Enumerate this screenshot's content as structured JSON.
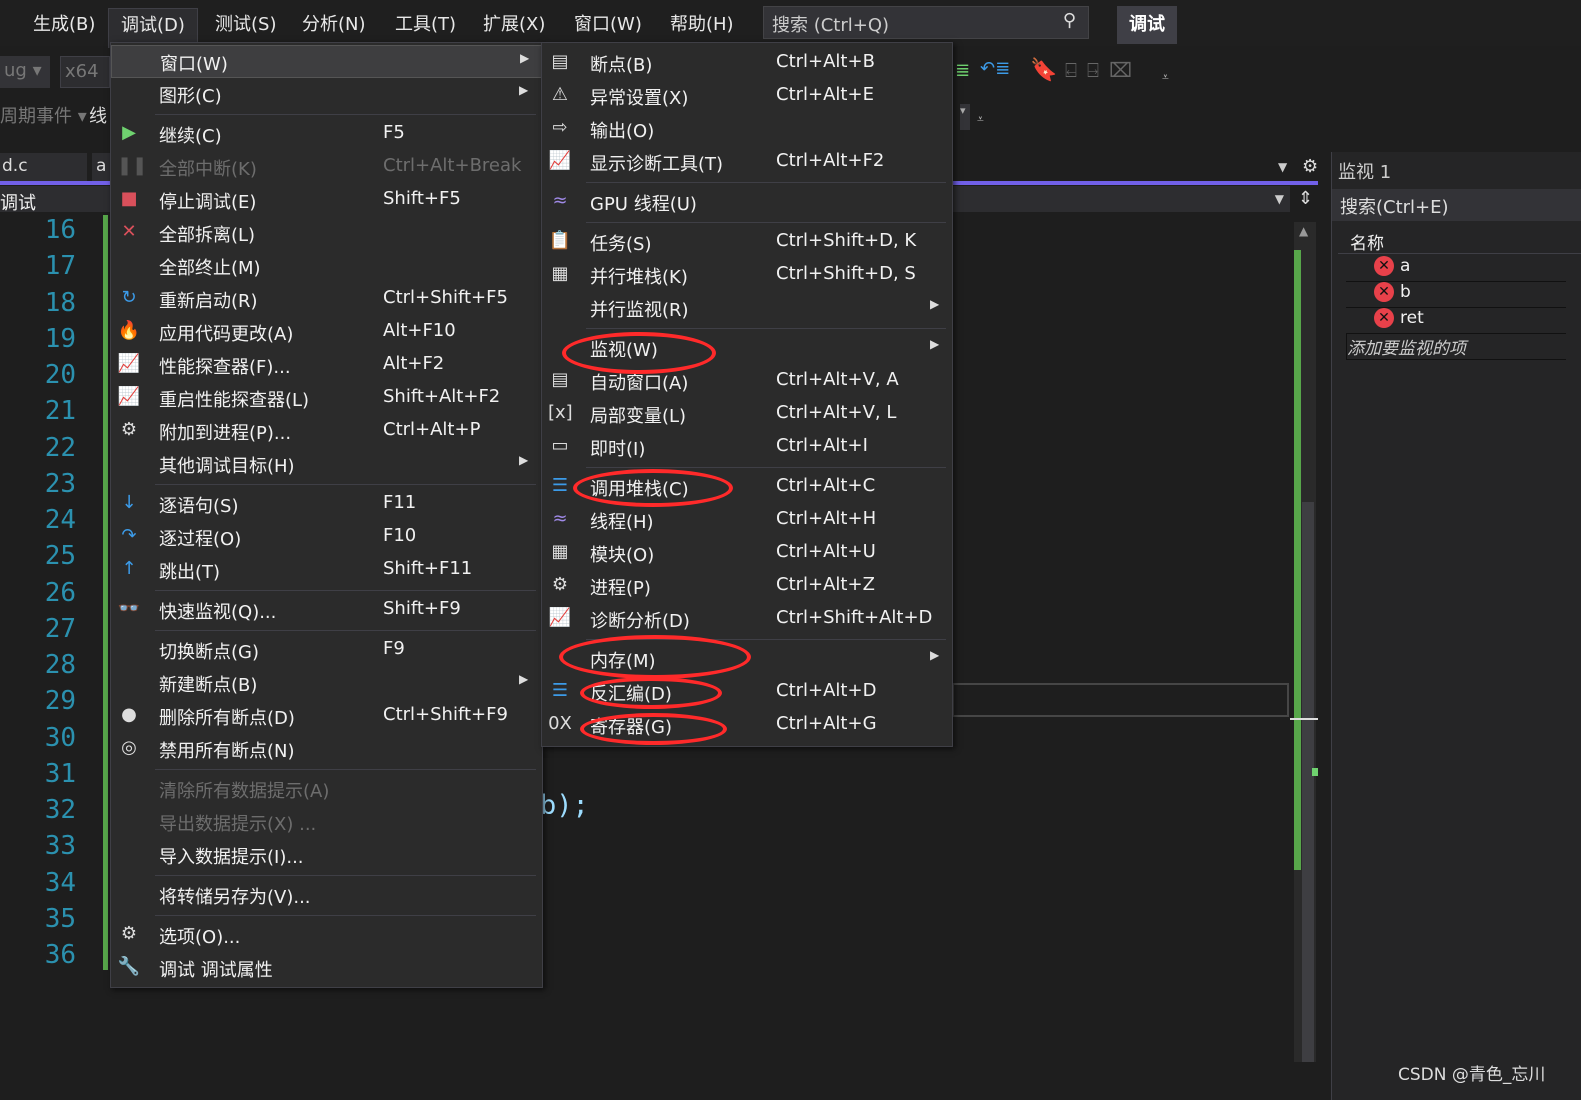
{
  "menubar": {
    "items": [
      "生成(B)",
      "调试(D)",
      "测试(S)",
      "分析(N)",
      "工具(T)",
      "扩展(X)",
      "窗口(W)",
      "帮助(H)"
    ],
    "search_placeholder": "搜索 (Ctrl+Q)",
    "mode_badge": "调试"
  },
  "toolbar": {
    "config": "ug",
    "platform": "x64",
    "lifecycle": "周期事件",
    "thread": "线"
  },
  "tabs": {
    "file1": "d.c",
    "file2": "a",
    "scope": "调试"
  },
  "editor": {
    "line_numbers": [
      "16",
      "17",
      "18",
      "19",
      "20",
      "21",
      "22",
      "23",
      "24",
      "25",
      "26",
      "27",
      "28",
      "29",
      "30",
      "31",
      "32",
      "33",
      "34",
      "35",
      "36"
    ],
    "code_fragment": "b);"
  },
  "debug_menu": [
    {
      "label": "窗口(W)",
      "sub": true,
      "hl": true
    },
    {
      "label": "图形(C)",
      "sub": true
    },
    {
      "sep": true
    },
    {
      "label": "继续(C)",
      "sc": "F5",
      "icon": "play-icon",
      "glyph": "▶",
      "color": "#6fd26f"
    },
    {
      "label": "全部中断(K)",
      "sc": "Ctrl+Alt+Break",
      "icon": "pause-icon",
      "glyph": "❚❚",
      "color": "#555",
      "dis": true
    },
    {
      "label": "停止调试(E)",
      "sc": "Shift+F5",
      "icon": "stop-icon",
      "glyph": "■",
      "color": "#d9505b"
    },
    {
      "label": "全部拆离(L)",
      "icon": "detach-icon",
      "glyph": "✕",
      "color": "#d9505b"
    },
    {
      "label": "全部终止(M)"
    },
    {
      "label": "重新启动(R)",
      "sc": "Ctrl+Shift+F5",
      "icon": "restart-icon",
      "glyph": "↻",
      "color": "#3c9be8"
    },
    {
      "label": "应用代码更改(A)",
      "sc": "Alt+F10",
      "icon": "hot-reload-icon",
      "glyph": "🔥",
      "color": "#e8414a"
    },
    {
      "label": "性能探查器(F)...",
      "sc": "Alt+F2",
      "icon": "profiler-icon",
      "glyph": "📈",
      "color": "#8bc58b"
    },
    {
      "label": "重启性能探查器(L)",
      "sc": "Shift+Alt+F2",
      "icon": "restart-profiler-icon",
      "glyph": "📈",
      "color": "#8bc58b"
    },
    {
      "label": "附加到进程(P)...",
      "sc": "Ctrl+Alt+P",
      "icon": "gears-icon",
      "glyph": "⚙",
      "color": "#ddd"
    },
    {
      "label": "其他调试目标(H)",
      "sub": true
    },
    {
      "sep": true
    },
    {
      "label": "逐语句(S)",
      "sc": "F11",
      "icon": "step-into-icon",
      "glyph": "↓",
      "color": "#3c9be8"
    },
    {
      "label": "逐过程(O)",
      "sc": "F10",
      "icon": "step-over-icon",
      "glyph": "↷",
      "color": "#3c9be8"
    },
    {
      "label": "跳出(T)",
      "sc": "Shift+F11",
      "icon": "step-out-icon",
      "glyph": "↑",
      "color": "#3c9be8"
    },
    {
      "sep": true
    },
    {
      "label": "快速监视(Q)...",
      "sc": "Shift+F9",
      "icon": "glasses-icon",
      "glyph": "👓",
      "color": "#ddd"
    },
    {
      "sep": true
    },
    {
      "label": "切换断点(G)",
      "sc": "F9"
    },
    {
      "label": "新建断点(B)",
      "sub": true
    },
    {
      "label": "删除所有断点(D)",
      "sc": "Ctrl+Shift+F9",
      "icon": "delete-breakpoints-icon",
      "glyph": "●",
      "color": "#ddd"
    },
    {
      "label": "禁用所有断点(N)",
      "icon": "disable-breakpoints-icon",
      "glyph": "◎",
      "color": "#ddd"
    },
    {
      "sep": true
    },
    {
      "label": "清除所有数据提示(A)",
      "dis": true
    },
    {
      "label": "导出数据提示(X) ...",
      "dis": true
    },
    {
      "label": "导入数据提示(I)..."
    },
    {
      "sep": true
    },
    {
      "label": "将转储另存为(V)..."
    },
    {
      "sep": true
    },
    {
      "label": "选项(O)...",
      "icon": "gear-icon",
      "glyph": "⚙",
      "color": "#ddd"
    },
    {
      "label": "调试 调试属性",
      "icon": "wrench-icon",
      "glyph": "🔧",
      "color": "#ddd"
    }
  ],
  "window_submenu": [
    {
      "label": "断点(B)",
      "sc": "Ctrl+Alt+B",
      "icon": "breakpoints-icon",
      "glyph": "▤",
      "color": "#ddd"
    },
    {
      "label": "异常设置(X)",
      "sc": "Ctrl+Alt+E",
      "icon": "exception-icon",
      "glyph": "⚠",
      "color": "#ddd"
    },
    {
      "label": "输出(O)",
      "sc": "",
      "icon": "output-icon",
      "glyph": "⇨",
      "color": "#ddd"
    },
    {
      "label": "显示诊断工具(T)",
      "sc": "Ctrl+Alt+F2",
      "icon": "diagnostics-icon",
      "glyph": "📈",
      "color": "#ddd"
    },
    {
      "sep": true
    },
    {
      "label": "GPU 线程(U)",
      "icon": "gpu-threads-icon",
      "glyph": "≈",
      "color": "#a08ae8"
    },
    {
      "sep": true
    },
    {
      "label": "任务(S)",
      "sc": "Ctrl+Shift+D, K",
      "icon": "tasks-icon",
      "glyph": "📋",
      "color": "#ddd"
    },
    {
      "label": "并行堆栈(K)",
      "sc": "Ctrl+Shift+D, S",
      "icon": "parallel-stacks-icon",
      "glyph": "▦",
      "color": "#ddd"
    },
    {
      "label": "并行监视(R)",
      "sub": true
    },
    {
      "sep": true
    },
    {
      "label": "监视(W)",
      "sub": true
    },
    {
      "label": "自动窗口(A)",
      "sc": "Ctrl+Alt+V, A",
      "icon": "autos-icon",
      "glyph": "▤",
      "color": "#ddd"
    },
    {
      "label": "局部变量(L)",
      "sc": "Ctrl+Alt+V, L",
      "icon": "locals-icon",
      "glyph": "[x]",
      "color": "#ddd"
    },
    {
      "label": "即时(I)",
      "sc": "Ctrl+Alt+I",
      "icon": "immediate-icon",
      "glyph": "▭",
      "color": "#ddd"
    },
    {
      "sep": true
    },
    {
      "label": "调用堆栈(C)",
      "sc": "Ctrl+Alt+C",
      "icon": "call-stack-icon",
      "glyph": "☰",
      "color": "#3c9be8"
    },
    {
      "label": "线程(H)",
      "sc": "Ctrl+Alt+H",
      "icon": "threads-icon",
      "glyph": "≈",
      "color": "#a08ae8"
    },
    {
      "label": "模块(O)",
      "sc": "Ctrl+Alt+U",
      "icon": "modules-icon",
      "glyph": "▦",
      "color": "#ddd"
    },
    {
      "label": "进程(P)",
      "sc": "Ctrl+Alt+Z",
      "icon": "processes-icon",
      "glyph": "⚙",
      "color": "#ddd"
    },
    {
      "label": "诊断分析(D)",
      "sc": "Ctrl+Shift+Alt+D",
      "icon": "diagnostic-analysis-icon",
      "glyph": "📈",
      "color": "#ddd"
    },
    {
      "sep": true
    },
    {
      "label": "内存(M)",
      "sub": true
    },
    {
      "label": "反汇编(D)",
      "sc": "Ctrl+Alt+D",
      "icon": "disassembly-icon",
      "glyph": "☰",
      "color": "#3c9be8"
    },
    {
      "label": "寄存器(G)",
      "sc": "Ctrl+Alt+G",
      "icon": "registers-icon",
      "glyph": "0X",
      "color": "#ddd"
    }
  ],
  "watch": {
    "title": "监视 1",
    "search_placeholder": "搜索(Ctrl+E)",
    "col_name": "名称",
    "items": [
      "a",
      "b",
      "ret"
    ],
    "add_hint": "添加要监视的项"
  },
  "watermark": "CSDN @青色_忘川",
  "colors": {
    "annotation": "#ff2a2a",
    "accent": "#7160e8"
  }
}
